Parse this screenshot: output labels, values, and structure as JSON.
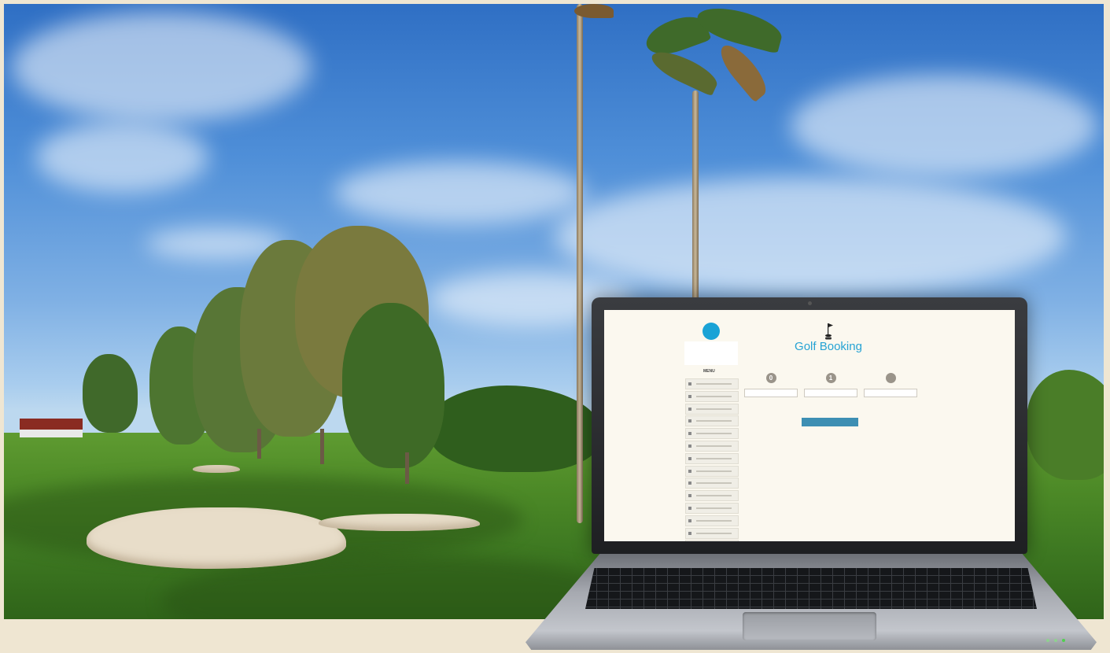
{
  "page": {
    "badge_text": "",
    "menu_label": "MENU",
    "title": "Golf Booking",
    "subtitle": "",
    "cta_label": ""
  },
  "sidebar_items": [
    "",
    "",
    "",
    "",
    "",
    "",
    "",
    "",
    "",
    "",
    "",
    "",
    "",
    "",
    ""
  ],
  "steps": [
    {
      "number": "0",
      "label": "",
      "field_value": ""
    },
    {
      "number": "1",
      "label": "",
      "field_value": ""
    },
    {
      "number": "",
      "label": "",
      "field_value": ""
    }
  ],
  "colors": {
    "accent": "#26a3d4",
    "button": "#3d8fb3",
    "page_bg": "#fbf8ef",
    "frame_bg": "#efe6d2"
  },
  "icons": [
    "flag-icon",
    "logo-badge-icon",
    "menu-item-icon"
  ]
}
